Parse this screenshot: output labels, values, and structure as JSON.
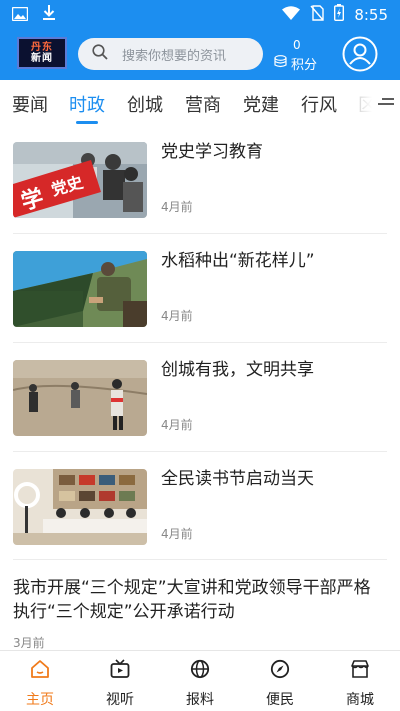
{
  "status_bar": {
    "time": "8:55"
  },
  "header": {
    "logo_line1": "丹东",
    "logo_line2": "新闻",
    "search_placeholder": "搜索你想要的资讯",
    "points_value": "0",
    "points_label": "积分"
  },
  "tabs": [
    {
      "label": "要闻",
      "active": false
    },
    {
      "label": "时政",
      "active": true
    },
    {
      "label": "创城",
      "active": false
    },
    {
      "label": "营商",
      "active": false
    },
    {
      "label": "党建",
      "active": false
    },
    {
      "label": "行风",
      "active": false
    },
    {
      "label": "区",
      "active": false
    }
  ],
  "news": [
    {
      "title": "党史学习教育",
      "time": "4月前",
      "thumb": "party-study-photo"
    },
    {
      "title": "水稻种出“新花样儿”",
      "time": "4月前",
      "thumb": "rice-seedling-photo"
    },
    {
      "title": "创城有我，文明共享",
      "time": "4月前",
      "thumb": "volunteers-cleanup-photo"
    },
    {
      "title": "全民读书节启动当天",
      "time": "4月前",
      "thumb": "reading-festival-photo"
    },
    {
      "title": "我市开展“三个规定”大宣讲和党政领导干部严格执行“三个规定”公开承诺行动",
      "time": "3月前"
    }
  ],
  "bottom_nav": [
    {
      "label": "主页",
      "icon": "home-icon",
      "active": true
    },
    {
      "label": "视听",
      "icon": "tv-icon",
      "active": false
    },
    {
      "label": "报料",
      "icon": "globe-icon",
      "active": false
    },
    {
      "label": "便民",
      "icon": "compass-icon",
      "active": false
    },
    {
      "label": "商城",
      "icon": "shop-icon",
      "active": false
    }
  ],
  "colors": {
    "brand_blue": "#1c8ef0",
    "active_orange": "#f07a1a"
  }
}
